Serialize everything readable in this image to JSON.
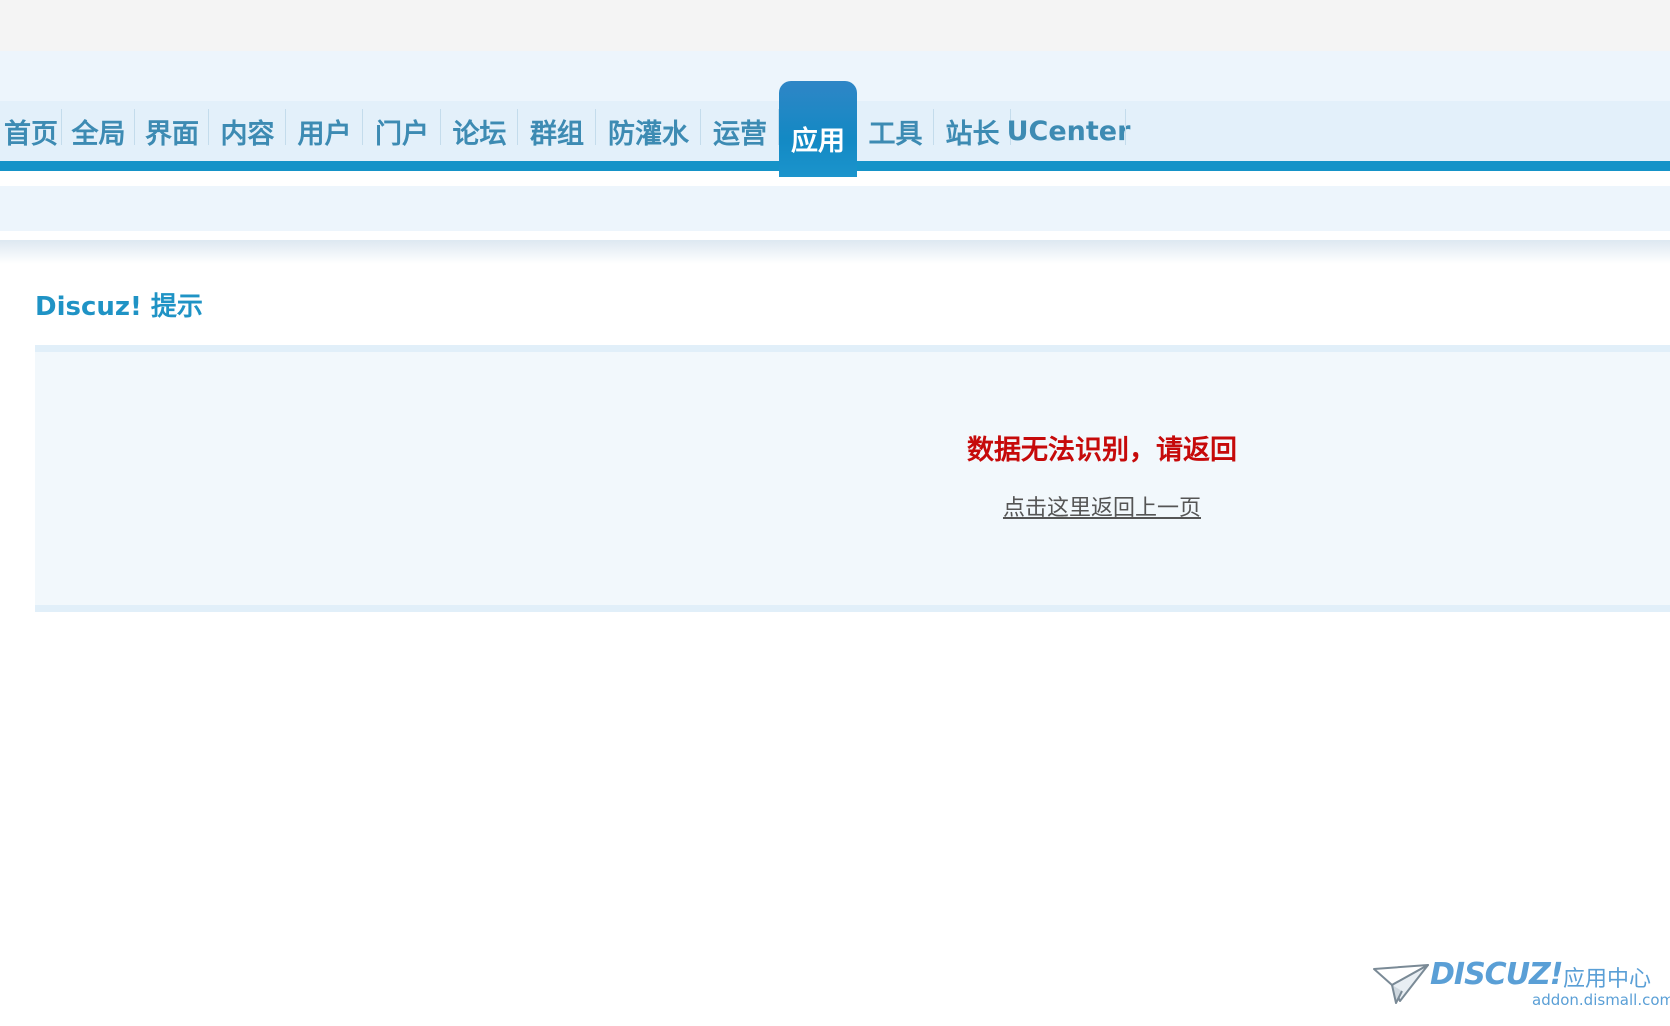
{
  "nav": {
    "items": [
      {
        "label": "首页"
      },
      {
        "label": "全局"
      },
      {
        "label": "界面"
      },
      {
        "label": "内容"
      },
      {
        "label": "用户"
      },
      {
        "label": "门户"
      },
      {
        "label": "论坛"
      },
      {
        "label": "群组"
      },
      {
        "label": "防灌水"
      },
      {
        "label": "运营"
      },
      {
        "label": "应用",
        "active": true
      },
      {
        "label": "工具"
      },
      {
        "label": "站长"
      },
      {
        "label": "UCenter"
      }
    ]
  },
  "page": {
    "title": "Discuz! 提示"
  },
  "message": {
    "text": "数据无法识别，请返回",
    "back_link": "点击这里返回上一页"
  },
  "watermark": {
    "brand": "DISCUZ!",
    "subtitle": "应用中心",
    "url": "addon.dismall.com"
  },
  "colors": {
    "accent": "#1593c8",
    "nav_text": "#3d8bb3",
    "error": "#c60a0a"
  }
}
